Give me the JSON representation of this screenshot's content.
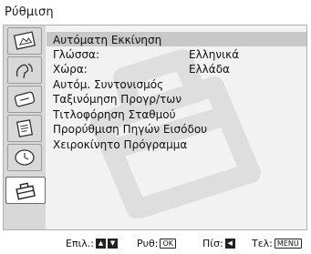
{
  "title": "Ρύθμιση",
  "sidebar": {
    "tabs": [
      {
        "icon": "picture-icon"
      },
      {
        "icon": "sound-icon"
      },
      {
        "icon": "screen-icon"
      },
      {
        "icon": "features-icon"
      },
      {
        "icon": "clock-icon"
      },
      {
        "icon": "setup-toolbox-icon",
        "active": true
      }
    ]
  },
  "menu": {
    "items": [
      {
        "label": "Αυτόματη Εκκίνηση",
        "selected": true
      },
      {
        "label": "Γλώσσα:",
        "value": "Ελληνικά"
      },
      {
        "label": "Χώρα:",
        "value": "Ελλάδα"
      },
      {
        "label": "Αυτόμ. Συντονισμός"
      },
      {
        "label": "Ταξινόμηση Προγρ/των"
      },
      {
        "label": "Τιτλοφόρηση Σταθμού"
      },
      {
        "label": "Προρύθμιση Πηγών Εισόδου"
      },
      {
        "label": "Χειροκίνητο Πρόγραμμα"
      }
    ]
  },
  "footer": {
    "select_label": "Επιλ.:",
    "set_label": "Ρυθ:",
    "set_key": "OK",
    "back_label": "Πίσ:",
    "exit_label": "Τελ:",
    "exit_key": "MENU"
  },
  "colors": {
    "highlight": "#c8c8c8",
    "panel": "#f2f2f2",
    "frame": "#d8d8d8"
  }
}
